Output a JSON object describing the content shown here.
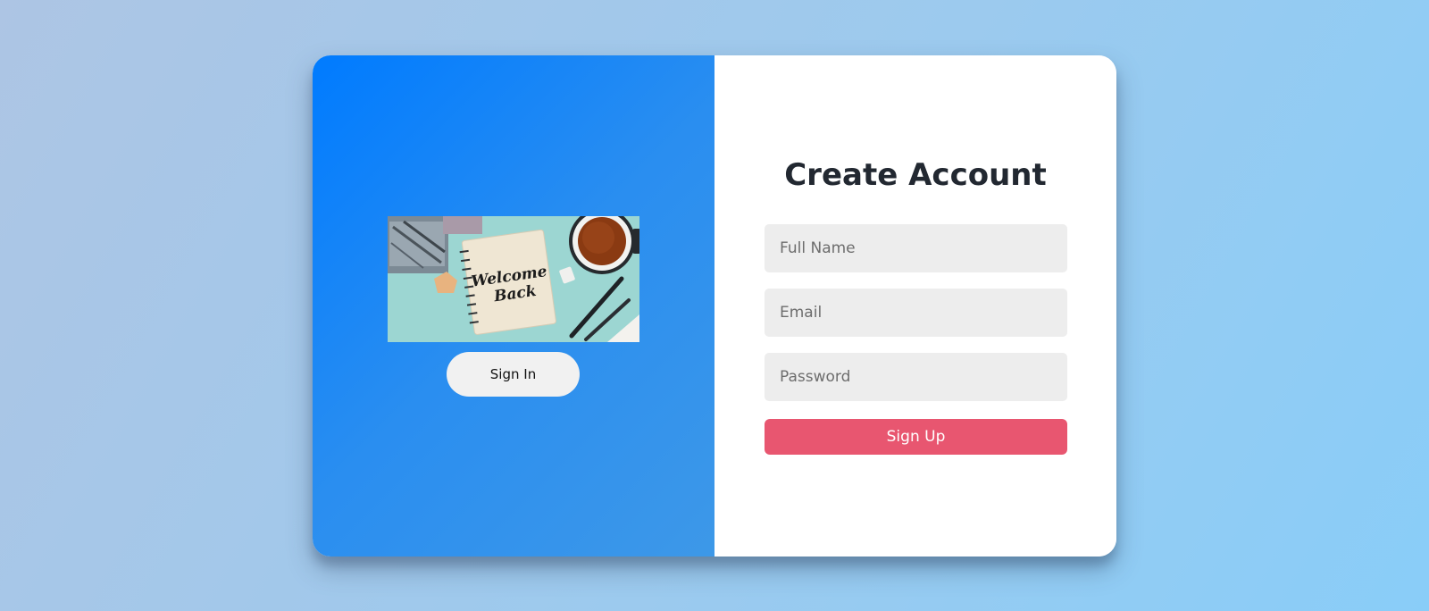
{
  "left_panel": {
    "image": {
      "text_line1": "Welcome",
      "text_line2": "Back"
    },
    "signin_label": "Sign In"
  },
  "form": {
    "title": "Create Account",
    "fields": {
      "name_placeholder": "Full Name",
      "email_placeholder": "Email",
      "password_placeholder": "Password"
    },
    "signup_label": "Sign Up"
  },
  "colors": {
    "panel_gradient_start": "#007bff",
    "panel_gradient_end": "#3d98e8",
    "signup_button": "#e85670",
    "input_background": "#ededed",
    "page_background": "#9ccaee"
  }
}
